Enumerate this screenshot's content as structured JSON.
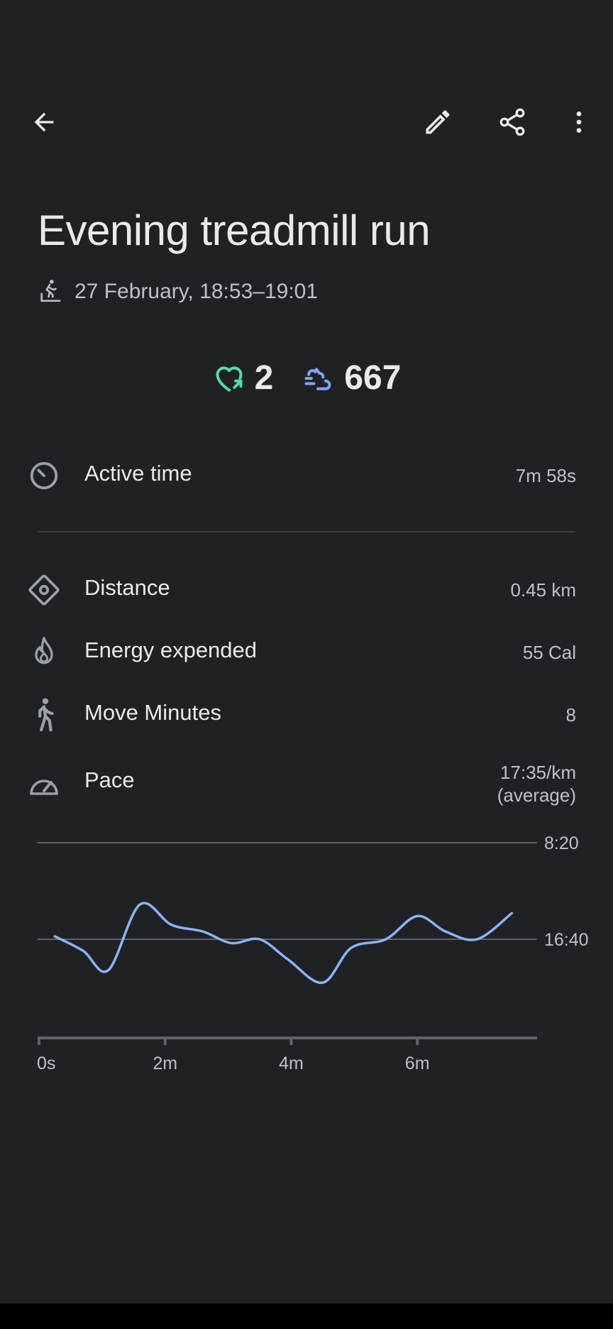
{
  "header": {
    "back_icon": "arrow-back-icon",
    "edit_icon": "pencil-icon",
    "share_icon": "share-icon",
    "more_icon": "more-vert-icon"
  },
  "activity": {
    "title": "Evening treadmill run",
    "date_time": "27 February, 18:53–19:01",
    "type_icon": "treadmill-icon"
  },
  "points": {
    "heart_points": "2",
    "steps": "667",
    "heart_color": "#5bd6a7",
    "steps_color": "#7ea5f5"
  },
  "stats": {
    "active_time": {
      "label": "Active time",
      "value": "7m 58s"
    },
    "distance": {
      "label": "Distance",
      "value": "0.45 km"
    },
    "energy": {
      "label": "Energy expended",
      "value": "55 Cal"
    },
    "move_minutes": {
      "label": "Move Minutes",
      "value": "8"
    },
    "pace": {
      "label": "Pace",
      "value_line1": "17:35/km",
      "value_line2": "(average)"
    }
  },
  "chart_data": {
    "type": "line",
    "line_color": "#8ab4f8",
    "x_unit": "minutes",
    "y_unit": "pace min:sec per km (inverted axis)",
    "x_ticks": [
      "0s",
      "2m",
      "4m",
      "6m"
    ],
    "y_ticks": [
      "8:20",
      "16:40"
    ],
    "x": [
      0.25,
      0.7,
      1.1,
      1.6,
      2.1,
      2.6,
      3.05,
      3.5,
      3.95,
      4.5,
      4.95,
      5.5,
      6.0,
      6.45,
      6.95,
      7.5
    ],
    "series": [
      {
        "values": [
          "16:25",
          "17:40",
          "19:20",
          "13:40",
          "15:25",
          "16:00",
          "17:00",
          "16:40",
          "18:25",
          "20:25",
          "17:25",
          "16:40",
          "14:40",
          "16:00",
          "16:40",
          "14:25"
        ]
      }
    ]
  }
}
